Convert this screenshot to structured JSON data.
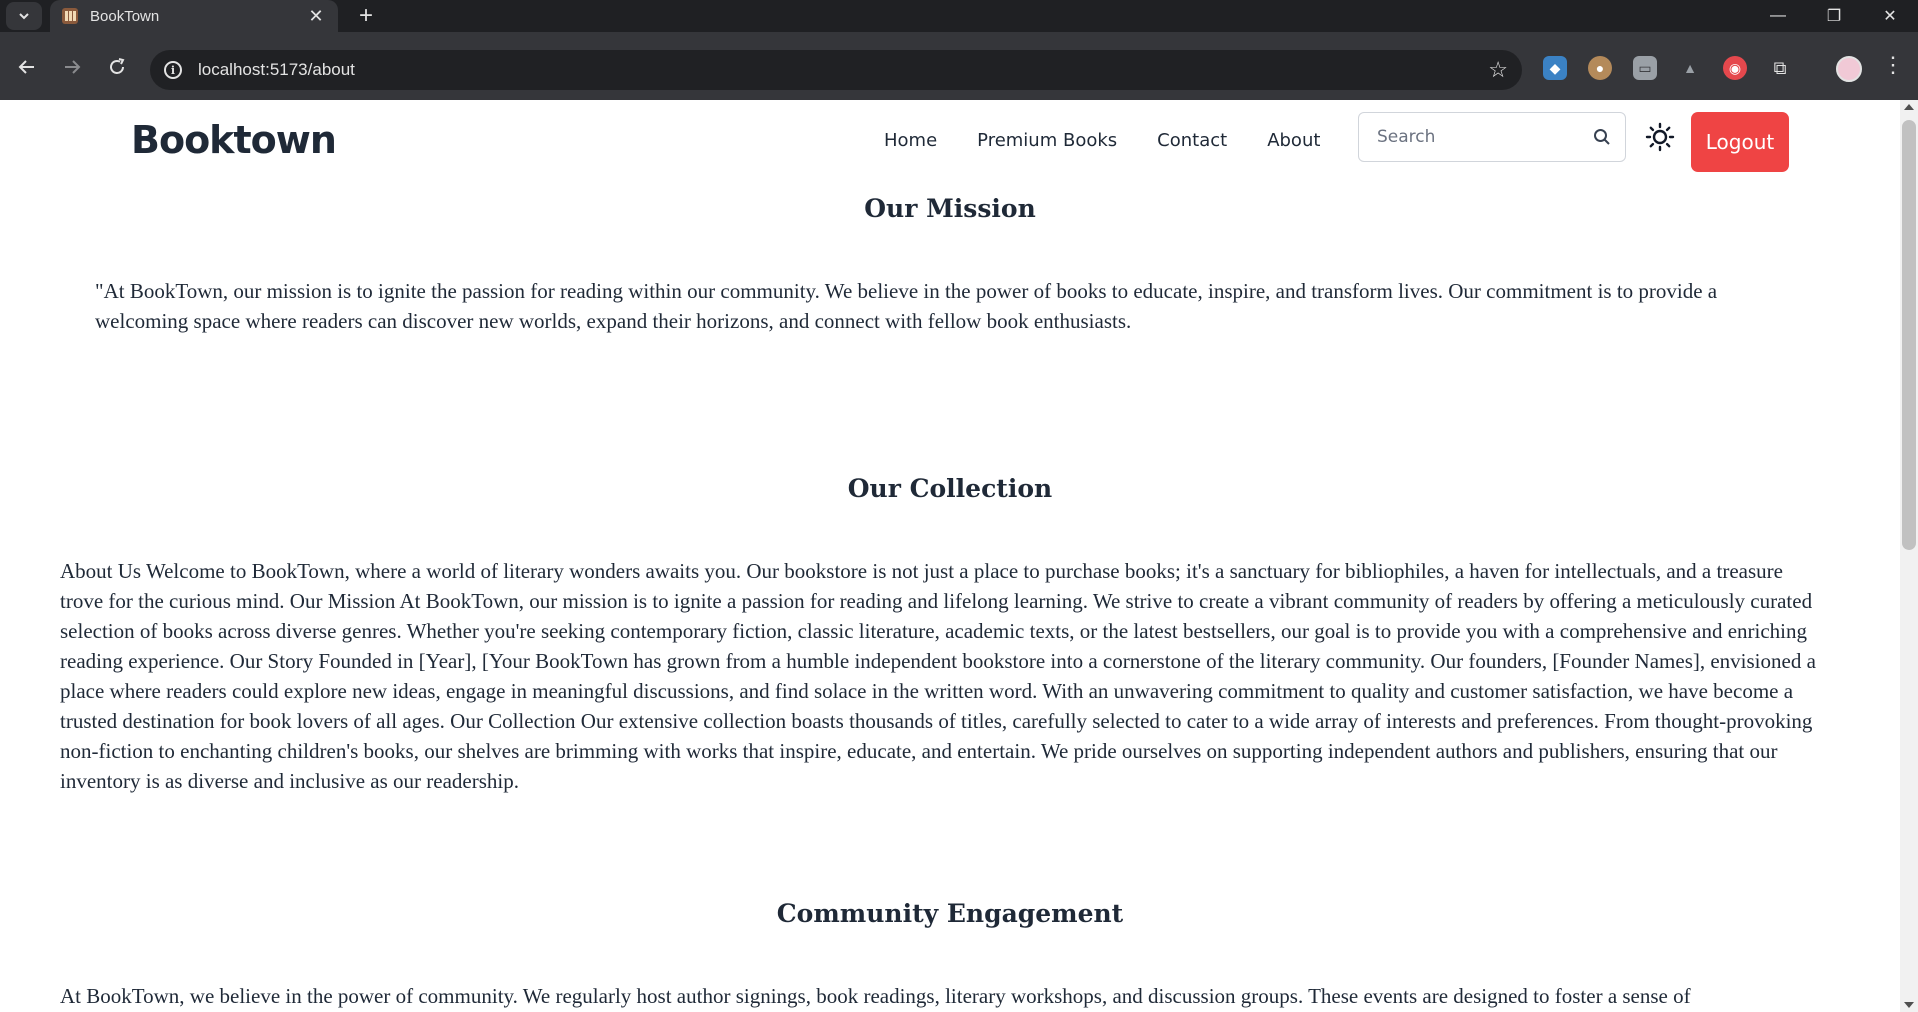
{
  "browser": {
    "tab_title": "BookTown",
    "url": "localhost:5173/about"
  },
  "site": {
    "logo": "Booktown",
    "nav": [
      "Home",
      "Premium Books",
      "Contact",
      "About"
    ],
    "search_placeholder": "Search",
    "logout_label": "Logout",
    "logout_color": "#ef4444"
  },
  "sections": [
    {
      "title": "Our Mission",
      "text": "\"At BookTown, our mission is to ignite the passion for reading within our community. We believe in the power of books to educate, inspire, and transform lives. Our commitment is to provide a welcoming space where readers can discover new worlds, expand their horizons, and connect with fellow book enthusiasts."
    },
    {
      "title": "Our Collection",
      "text": "About Us Welcome to BookTown, where a world of literary wonders awaits you. Our bookstore is not just a place to purchase books; it's a sanctuary for bibliophiles, a haven for intellectuals, and a treasure trove for the curious mind. Our Mission At BookTown, our mission is to ignite a passion for reading and lifelong learning. We strive to create a vibrant community of readers by offering a meticulously curated selection of books across diverse genres. Whether you're seeking contemporary fiction, classic literature, academic texts, or the latest bestsellers, our goal is to provide you with a comprehensive and enriching reading experience. Our Story Founded in [Year], [Your BookTown has grown from a humble independent bookstore into a cornerstone of the literary community. Our founders, [Founder Names], envisioned a place where readers could explore new ideas, engage in meaningful discussions, and find solace in the written word. With an unwavering commitment to quality and customer satisfaction, we have become a trusted destination for book lovers of all ages. Our Collection Our extensive collection boasts thousands of titles, carefully selected to cater to a wide array of interests and preferences. From thought-provoking non-fiction to enchanting children's books, our shelves are brimming with works that inspire, educate, and entertain. We pride ourselves on supporting independent authors and publishers, ensuring that our inventory is as diverse and inclusive as our readership."
    },
    {
      "title": "Community Engagement",
      "text": "At BookTown, we believe in the power of community. We regularly host author signings, book readings, literary workshops, and discussion groups. These events are designed to foster a sense of"
    }
  ]
}
